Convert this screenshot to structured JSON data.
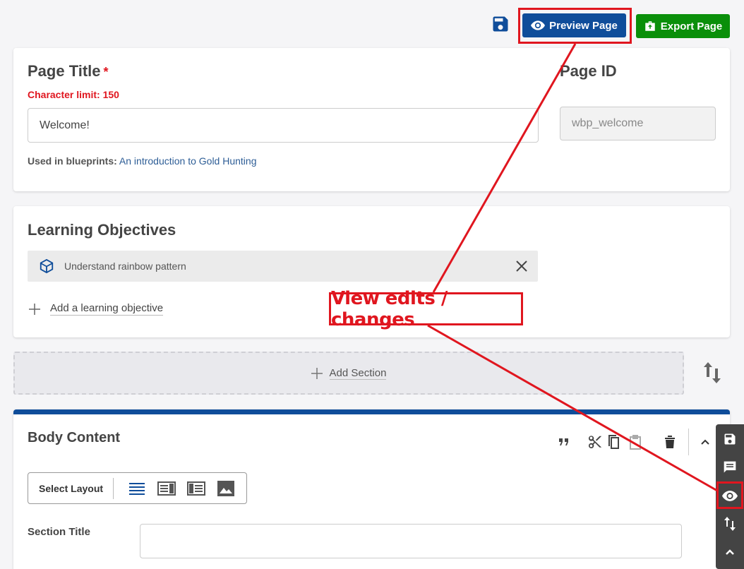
{
  "toolbar": {
    "preview_label": "Preview Page",
    "export_label": "Export Page"
  },
  "page_title": {
    "label": "Page Title",
    "required_mark": "*",
    "char_limit": "Character limit: 150",
    "value": "Welcome!",
    "used_in_label": "Used in blueprints:",
    "used_in_link": "An introduction to Gold Hunting"
  },
  "page_id": {
    "label": "Page ID",
    "value": "wbp_welcome"
  },
  "learning_objectives": {
    "heading": "Learning Objectives",
    "items": [
      {
        "label": "Understand rainbow pattern"
      }
    ],
    "add_label": "Add a learning objective"
  },
  "add_section_label": "Add Section",
  "body_content": {
    "heading": "Body Content",
    "select_layout_label": "Select Layout",
    "section_title_label": "Section Title",
    "section_title_value": ""
  },
  "annotation": {
    "text": "View edits / changes"
  },
  "colors": {
    "primary_blue": "#0f4d9a",
    "export_green": "#0a8f0a",
    "highlight_red": "#e0161f"
  }
}
